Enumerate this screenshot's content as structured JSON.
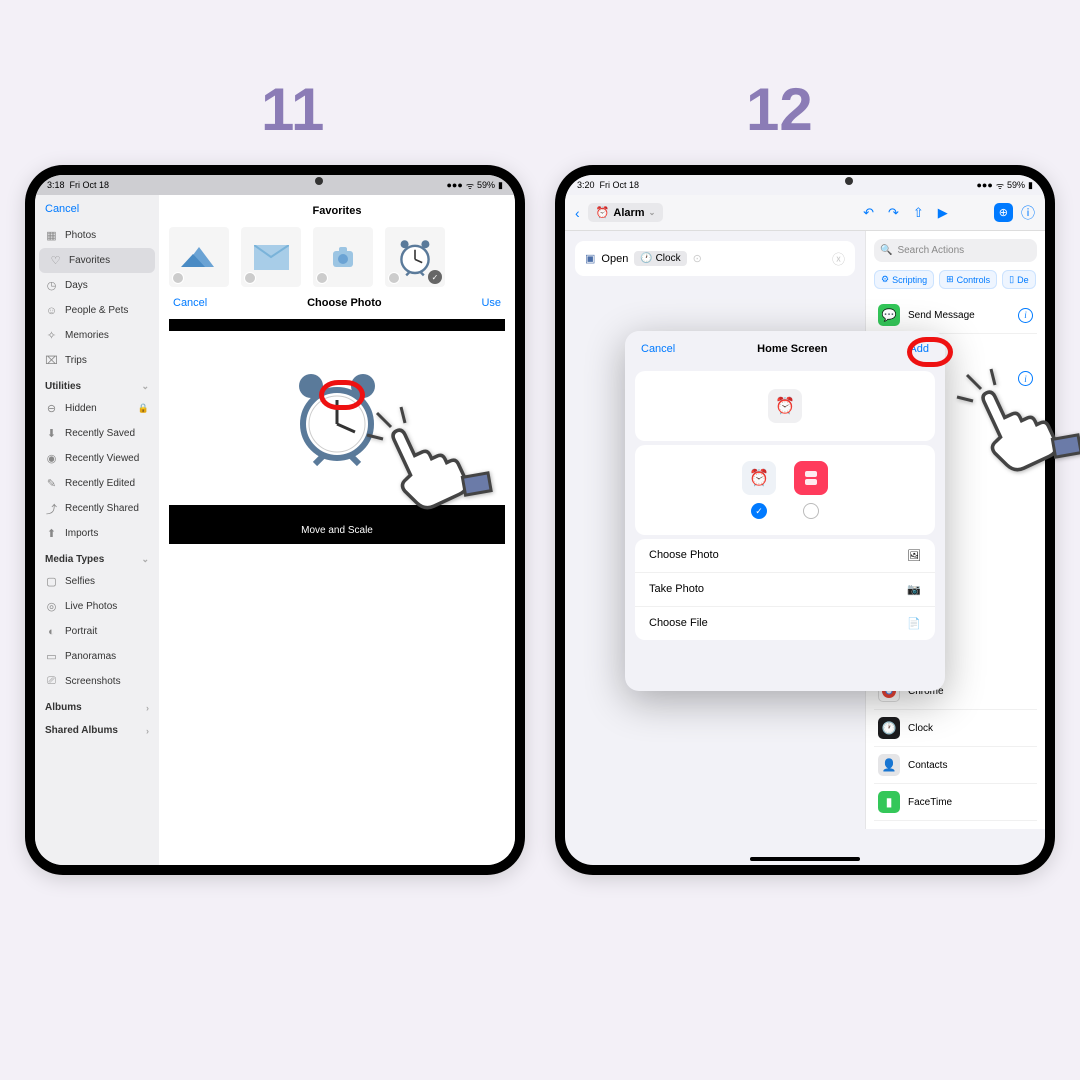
{
  "steps": {
    "s1": "11",
    "s2": "12"
  },
  "status": {
    "t1": "3:18",
    "t2": "3:20",
    "date": "Fri Oct 18",
    "bat": "59%"
  },
  "s1": {
    "cancel": "Cancel",
    "title": "Favorites",
    "sidebar": {
      "items": [
        "Photos",
        "Favorites",
        "Days",
        "People & Pets",
        "Memories",
        "Trips"
      ],
      "util_hdr": "Utilities",
      "util": [
        "Hidden",
        "Recently Saved",
        "Recently Viewed",
        "Recently Edited",
        "Recently Shared",
        "Imports"
      ],
      "media_hdr": "Media Types",
      "media": [
        "Selfies",
        "Live Photos",
        "Portrait",
        "Panoramas",
        "Screenshots"
      ],
      "albums": "Albums",
      "shared": "Shared Albums"
    },
    "crop": {
      "cancel": "Cancel",
      "title": "Choose Photo",
      "use": "Use",
      "move": "Move and Scale"
    }
  },
  "s2": {
    "title": "Alarm",
    "back": "‹",
    "action": {
      "open": "Open",
      "app": "Clock"
    },
    "search": "Search Actions",
    "chips": [
      "Scripting",
      "Controls",
      "De"
    ],
    "send": "Send Message",
    "apps": [
      "Chrome",
      "Clock",
      "Contacts",
      "FaceTime"
    ],
    "modal": {
      "cancel": "Cancel",
      "title": "Home Screen",
      "add": "Add",
      "rows": [
        "Choose Photo",
        "Take Photo",
        "Choose File"
      ]
    }
  }
}
